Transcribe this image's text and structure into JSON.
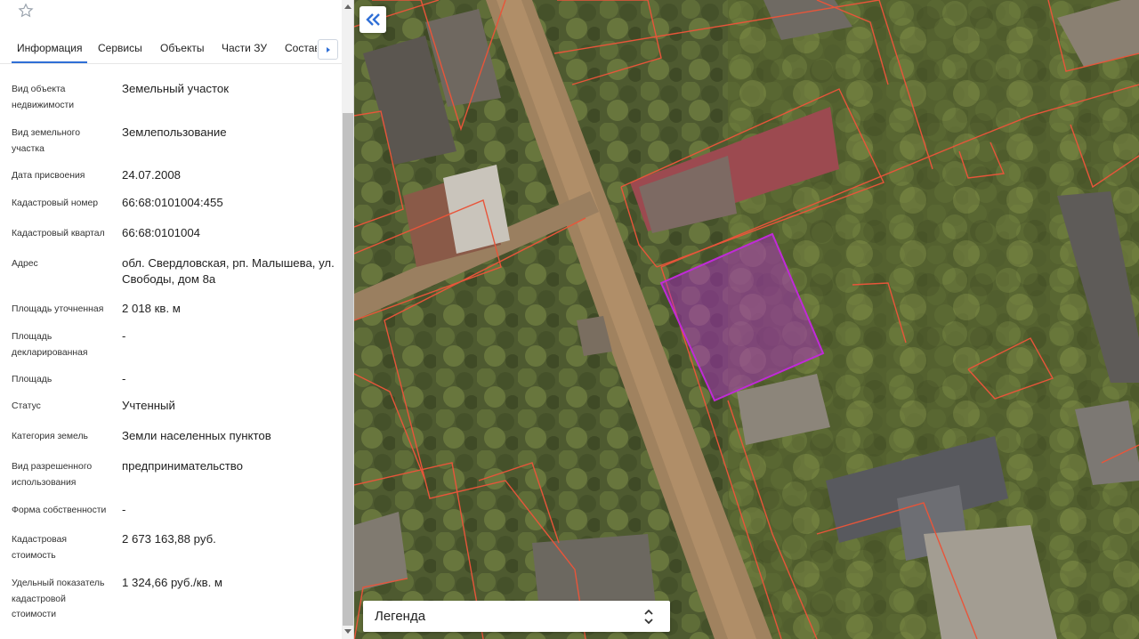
{
  "tabs": {
    "items": [
      "Информация",
      "Сервисы",
      "Объекты",
      "Части ЗУ",
      "Состав"
    ],
    "active": "Информация"
  },
  "info": {
    "rows": [
      {
        "label": "Вид объекта недвижимости",
        "value": "Земельный участок"
      },
      {
        "label": "Вид земельного участка",
        "value": "Землепользование"
      },
      {
        "label": "Дата присвоения",
        "value": "24.07.2008"
      },
      {
        "label": "Кадастровый номер",
        "value": "66:68:0101004:455"
      },
      {
        "label": "Кадастровый квартал",
        "value": "66:68:0101004"
      },
      {
        "label": "Адрес",
        "value": "обл. Свердловская, рп. Малышева, ул. Свободы, дом 8а"
      },
      {
        "label": "Площадь уточненная",
        "value": "2 018 кв. м"
      },
      {
        "label": "Площадь декларированная",
        "value": "-"
      },
      {
        "label": "Площадь",
        "value": "-"
      },
      {
        "label": "Статус",
        "value": "Учтенный"
      },
      {
        "label": "Категория земель",
        "value": "Земли населенных пунктов"
      },
      {
        "label": "Вид разрешенного использования",
        "value": "предпринимательство"
      },
      {
        "label": "Форма собственности",
        "value": "-"
      },
      {
        "label": "Кадастровая стоимость",
        "value": "2 673 163,88 руб."
      },
      {
        "label": "Удельный показатель кадастровой стоимости",
        "value": "1 324,66 руб./кв. м"
      }
    ]
  },
  "map": {
    "legend_label": "Легенда",
    "parcel_boundary_color": "#e8553a",
    "selected_parcel_color": "#c02ad8",
    "icons": {
      "favorite": "star-icon",
      "tabs_next": "chevron-right-icon",
      "collapse": "double-chevron-left-icon",
      "legend_toggle": "up-down-chevron-icon"
    }
  }
}
